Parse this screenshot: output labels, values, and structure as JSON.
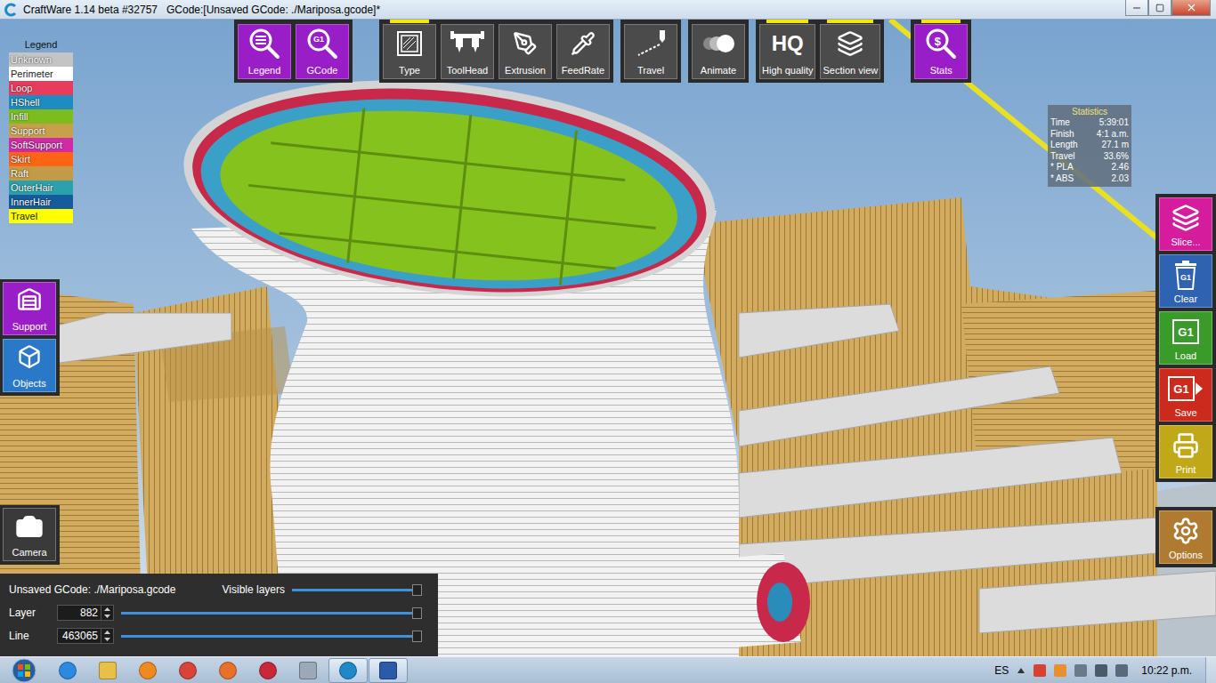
{
  "window": {
    "title": "CraftWare 1.14 beta #32757   GCode:[Unsaved GCode: ./Mariposa.gcode]*"
  },
  "legend": {
    "title": "Legend",
    "items": [
      {
        "label": "Unknown",
        "color": "#c4c4c4"
      },
      {
        "label": "Perimeter",
        "color": "#ffffff"
      },
      {
        "label": "Loop",
        "color": "#e83c5c"
      },
      {
        "label": "HShell",
        "color": "#1e8cc0"
      },
      {
        "label": "Infill",
        "color": "#7cbc1c"
      },
      {
        "label": "Support",
        "color": "#c8a04c"
      },
      {
        "label": "SoftSupport",
        "color": "#d22aa6"
      },
      {
        "label": "Skirt",
        "color": "#ff6414"
      },
      {
        "label": "Raft",
        "color": "#c29a48"
      },
      {
        "label": "OuterHair",
        "color": "#2ca0ac"
      },
      {
        "label": "InnerHair",
        "color": "#145c9c"
      },
      {
        "label": "Travel",
        "color": "#ffff00"
      }
    ]
  },
  "toolbar": {
    "groups": [
      [
        {
          "label": "Legend",
          "kind": "legend",
          "glyph": "",
          "active": false,
          "color": "#9a1ec8"
        },
        {
          "label": "GCode",
          "kind": "gcode",
          "glyph": "G1",
          "active": false,
          "color": "#9a1ec8"
        }
      ],
      [
        {
          "label": "Type",
          "kind": "type",
          "glyph": "",
          "active": true,
          "color": "#4b4b4b"
        },
        {
          "label": "ToolHead",
          "kind": "toolhead",
          "glyph": "",
          "active": false,
          "color": "#4b4b4b"
        },
        {
          "label": "Extrusion",
          "kind": "extrusion",
          "glyph": "",
          "active": false,
          "color": "#4b4b4b"
        },
        {
          "label": "FeedRate",
          "kind": "feedrate",
          "glyph": "",
          "active": false,
          "color": "#4b4b4b"
        }
      ],
      [
        {
          "label": "Travel",
          "kind": "travel",
          "glyph": "",
          "active": false,
          "color": "#4b4b4b"
        }
      ],
      [
        {
          "label": "Animate",
          "kind": "animate",
          "glyph": "",
          "active": false,
          "color": "#4b4b4b"
        }
      ],
      [
        {
          "label": "High quality",
          "kind": "hq",
          "glyph": "HQ",
          "active": true,
          "color": "#4b4b4b"
        },
        {
          "label": "Section view",
          "kind": "section",
          "glyph": "",
          "active": true,
          "color": "#4b4b4b"
        }
      ],
      [
        {
          "label": "Stats",
          "kind": "stats",
          "glyph": "$",
          "active": true,
          "color": "#9a1ec8"
        }
      ]
    ]
  },
  "statistics": {
    "title": "Statistics",
    "rows": [
      {
        "label": "Time",
        "value": "5:39:01"
      },
      {
        "label": "Finish",
        "value": "4:1 a.m."
      },
      {
        "label": "Length",
        "value": "27.1 m"
      },
      {
        "label": "Travel",
        "value": "33.6%"
      },
      {
        "label": "* PLA",
        "value": "2.46"
      },
      {
        "label": "* ABS",
        "value": "2.03"
      }
    ]
  },
  "actions": [
    {
      "label": "Slice...",
      "kind": "slice",
      "glyph": "",
      "color": "#d41c9c"
    },
    {
      "label": "Clear",
      "kind": "clear",
      "glyph": "G1",
      "color": "#2f62b0"
    },
    {
      "label": "Load",
      "kind": "load",
      "glyph": "G1",
      "color": "#3a9a2a"
    },
    {
      "label": "Save",
      "kind": "save",
      "glyph": "G1",
      "color": "#cc2a1c"
    },
    {
      "label": "Print",
      "kind": "print",
      "glyph": "",
      "color": "#c0a818"
    }
  ],
  "options": {
    "label": "Options",
    "color": "#b07a30"
  },
  "side_buttons": [
    {
      "label": "Support",
      "kind": "support",
      "color": "#9a1ec8"
    },
    {
      "label": "Objects",
      "kind": "objects",
      "color": "#2a78c8"
    }
  ],
  "camera": {
    "label": "Camera"
  },
  "layer_panel": {
    "file": "Unsaved GCode: ./Mariposa.gcode",
    "visible_layers": {
      "label": "Visible layers",
      "level": 1
    },
    "rows": [
      {
        "label": "Layer",
        "value": "882",
        "level": 1
      },
      {
        "label": "Line",
        "value": "463065",
        "level": 1
      }
    ]
  },
  "taskbar": {
    "apps": [
      {
        "kind": "ie",
        "color": "#2a8ae0",
        "selected": false
      },
      {
        "kind": "folder",
        "color": "#e8c048",
        "selected": false
      },
      {
        "kind": "media",
        "color": "#f08a20",
        "selected": false
      },
      {
        "kind": "chrome",
        "color": "#d8443a",
        "selected": false
      },
      {
        "kind": "firefox",
        "color": "#e8702a",
        "selected": false
      },
      {
        "kind": "app",
        "color": "#c8283a",
        "selected": false
      },
      {
        "kind": "calc",
        "color": "#9aa8b8",
        "selected": false
      },
      {
        "kind": "craftware",
        "color": "#1e88c8",
        "selected": true
      },
      {
        "kind": "word",
        "color": "#2a5aa8",
        "selected": true
      }
    ],
    "language": "ES",
    "clock": "10:22 p.m."
  }
}
